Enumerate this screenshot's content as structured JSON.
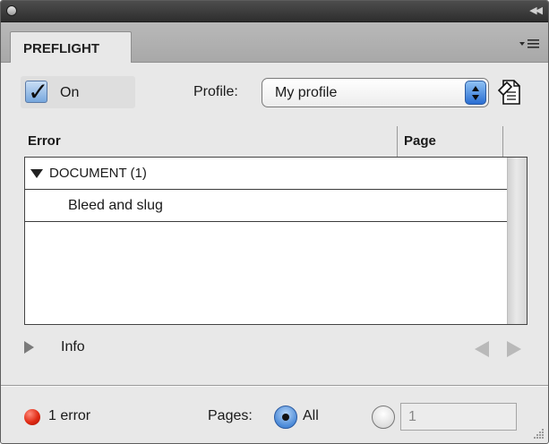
{
  "panel": {
    "tab_label": "PREFLIGHT"
  },
  "controls": {
    "on_label": "On",
    "on_checked": true,
    "profile_label": "Profile:",
    "profile_value": "My profile"
  },
  "table": {
    "columns": [
      "Error",
      "Page"
    ],
    "group": {
      "label": "DOCUMENT (1)",
      "expanded": true,
      "items": [
        {
          "label": "Bleed and slug",
          "page": ""
        }
      ]
    }
  },
  "info": {
    "label": "Info",
    "expanded": false
  },
  "status": {
    "error_text": "1 error",
    "status_color": "#e02a14",
    "pages_label": "Pages:",
    "all_label": "All",
    "all_selected": true,
    "range_value": "1"
  },
  "icons": {
    "close": "close-icon",
    "collapse": "double-chevron-left-icon",
    "menu": "panel-menu-icon",
    "profile": "profile-document-icon",
    "disclosure_down": "triangle-down-icon",
    "disclosure_right": "triangle-right-icon",
    "prev": "arrow-left-icon",
    "next": "arrow-right-icon",
    "resize": "resize-grip-icon"
  }
}
